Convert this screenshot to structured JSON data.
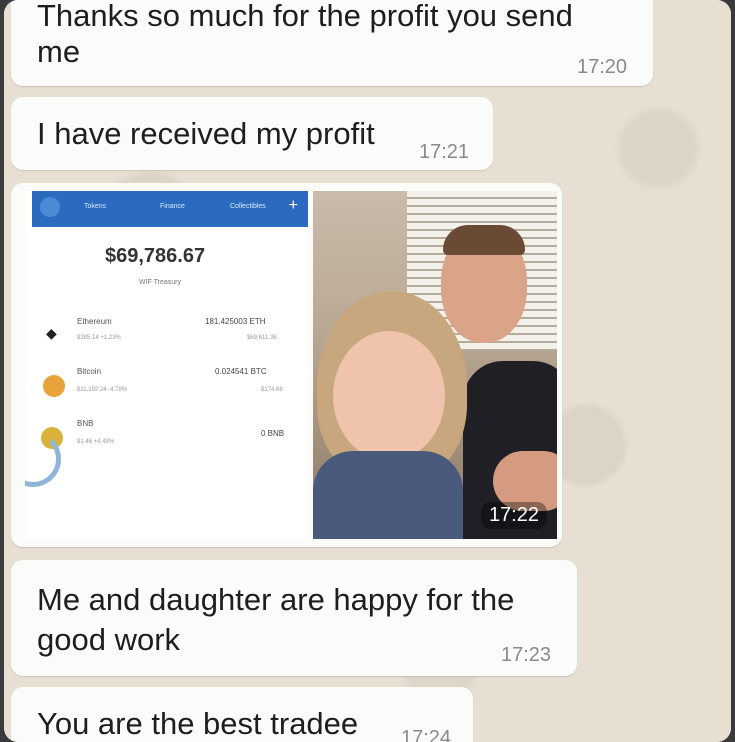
{
  "messages": [
    {
      "text_line1": "Thanks so much for the profit you send",
      "text_line2": "me",
      "time": "17:20"
    },
    {
      "text": "I have received my profit",
      "time": "17:21"
    },
    {
      "text_line1": "Me and daughter are happy for the",
      "text_line2": "good work",
      "time": "17:23"
    },
    {
      "text": "You are the best tradee",
      "time": "17:24"
    }
  ],
  "image_message": {
    "time": "17:22",
    "wallet": {
      "tabs": [
        "Tokens",
        "Finance",
        "Collectibles"
      ],
      "balance": "$69,786.67",
      "wallet_name": "WIF Treasury",
      "assets": [
        {
          "name": "Ethereum",
          "amount": "181.425003 ETH",
          "sub_left": "$385.14 +1.23%",
          "sub_right": "$69,611.36"
        },
        {
          "name": "Bitcoin",
          "amount": "0.024541 BTC",
          "sub_left": "$11,192.24 -4.78%",
          "sub_right": "$174.66"
        },
        {
          "name": "BNB",
          "amount": "0 BNB",
          "sub_left": "$1.46 +4.49%",
          "sub_right": ""
        }
      ]
    }
  },
  "colors": {
    "bubble": "#fbfbfa",
    "wallet_bar": "#2a6bbf",
    "time_text": "#8a8a8a"
  }
}
